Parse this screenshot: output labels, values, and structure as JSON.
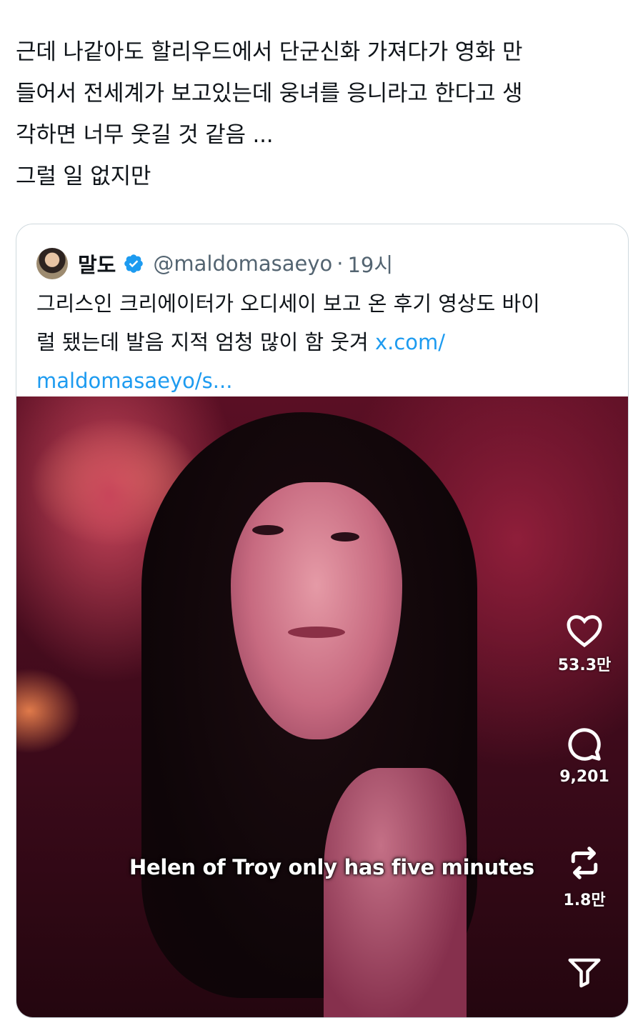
{
  "tweet": {
    "lines": [
      "근데 나같아도 할리우드에서 단군신화 가져다가 영화 만",
      "들어서 전세계가 보고있는데 웅녀를 응니라고 한다고 생",
      "각하면 너무 웃길 것 같음 ...",
      "그럴 일 없지만"
    ]
  },
  "quote": {
    "display_name": "말도",
    "handle": "@maldomasaeyo",
    "separator": "·",
    "time": "19시",
    "text_lines": [
      "그리스인 크리에이터가 오디세이 보고 온 후기 영상도 바이",
      "럴 됐는데 발음 지적 엄청 많이 함 웃겨 "
    ],
    "link_part1": "x.com/",
    "link_part2": "maldomasaeyo/s...",
    "media": {
      "caption": "Helen of Troy only has five minutes",
      "likes": "53.3만",
      "comments": "9,201",
      "reposts": "1.8만"
    }
  },
  "colors": {
    "link": "#1d9bf0",
    "verified": "#1d9bf0",
    "secondary_text": "#536471",
    "border": "#cfd9de"
  },
  "icons": [
    "verified-badge-icon",
    "heart-icon",
    "comment-icon",
    "repost-icon",
    "share-icon"
  ]
}
